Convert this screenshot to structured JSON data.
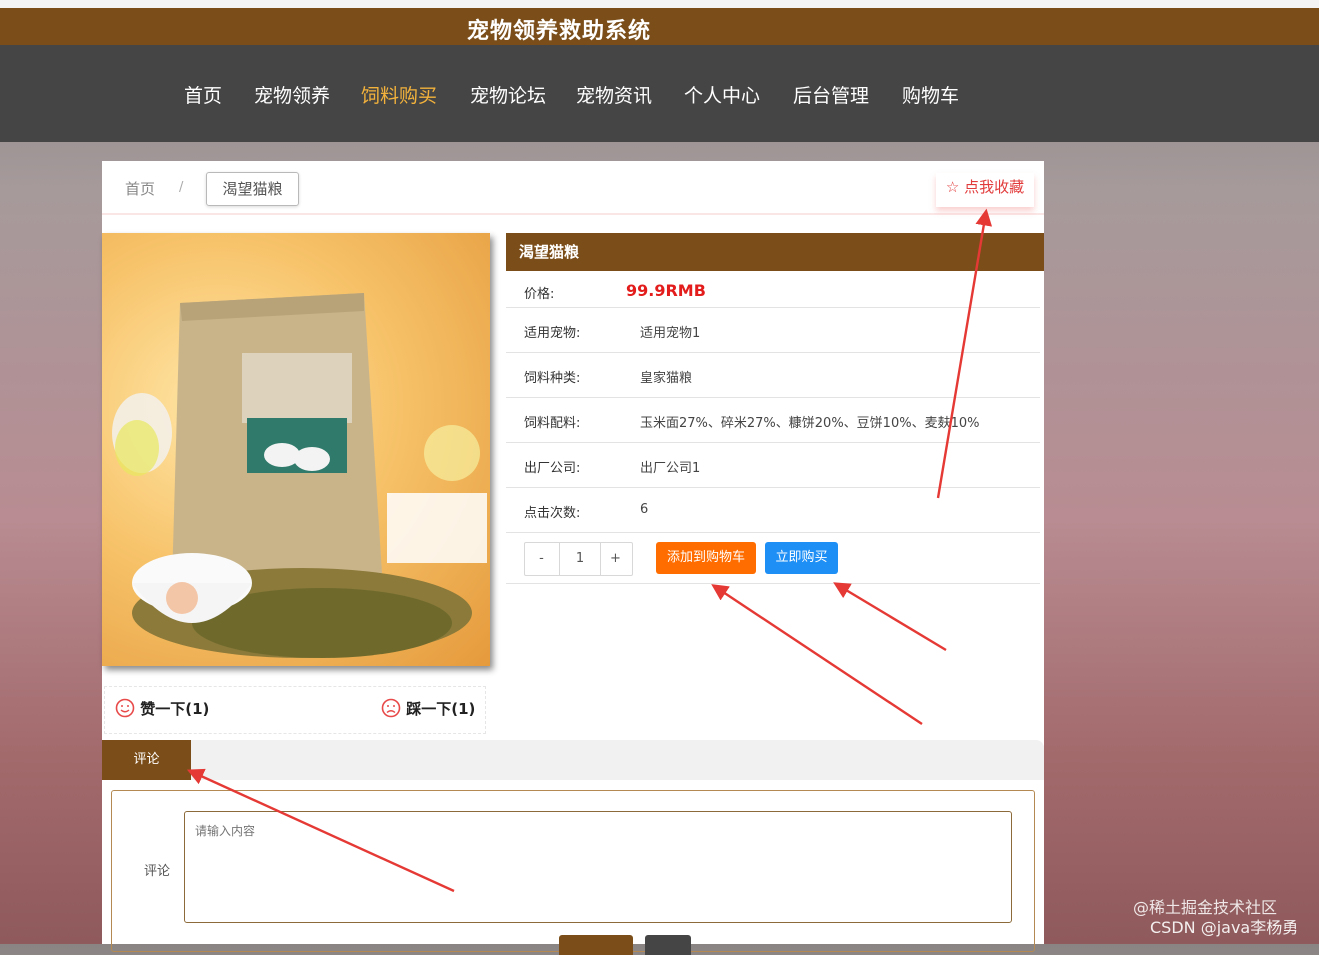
{
  "header": {
    "title": "宠物领养救助系统"
  },
  "nav": {
    "items": [
      {
        "label": "首页"
      },
      {
        "label": "宠物领养"
      },
      {
        "label": "饲料购买"
      },
      {
        "label": "宠物论坛"
      },
      {
        "label": "宠物资讯"
      },
      {
        "label": "个人中心"
      },
      {
        "label": "后台管理"
      },
      {
        "label": "购物车"
      }
    ],
    "active": "饲料购买"
  },
  "breadcrumb": {
    "home": "首页",
    "sep": "/",
    "current": "渴望猫粮"
  },
  "favorite": {
    "label": "☆ 点我收藏"
  },
  "product": {
    "name": "渴望猫粮",
    "price_label": "价格:",
    "price": "99.9RMB",
    "fields": [
      {
        "label": "适用宠物:",
        "value": "适用宠物1"
      },
      {
        "label": "饲料种类:",
        "value": "皇家猫粮"
      },
      {
        "label": "饲料配料:",
        "value": "玉米面27%、碎米27%、糠饼20%、豆饼10%、麦麸10%"
      },
      {
        "label": "出厂公司:",
        "value": "出厂公司1"
      },
      {
        "label": "点击次数:",
        "value": "6"
      }
    ],
    "quantity": "1",
    "minus": "-",
    "plus": "+",
    "add_to_cart": "添加到购物车",
    "buy_now": "立即购买"
  },
  "feedback": {
    "like": "赞一下(1)",
    "dislike": "踩一下(1)"
  },
  "comment": {
    "tab": "评论",
    "label": "评论",
    "placeholder": "请输入内容"
  },
  "watermark": {
    "line1": "@稀土掘金技术社区",
    "line2": "CSDN @java李杨勇"
  },
  "colors": {
    "brand_brown": "#7b4e19",
    "nav_bg": "#454545",
    "active_nav": "#f3b23b",
    "price_red": "#e31c1c",
    "cart_orange": "#ff6d00",
    "buy_blue": "#1e8ff5",
    "arrow_red": "#e53935"
  }
}
